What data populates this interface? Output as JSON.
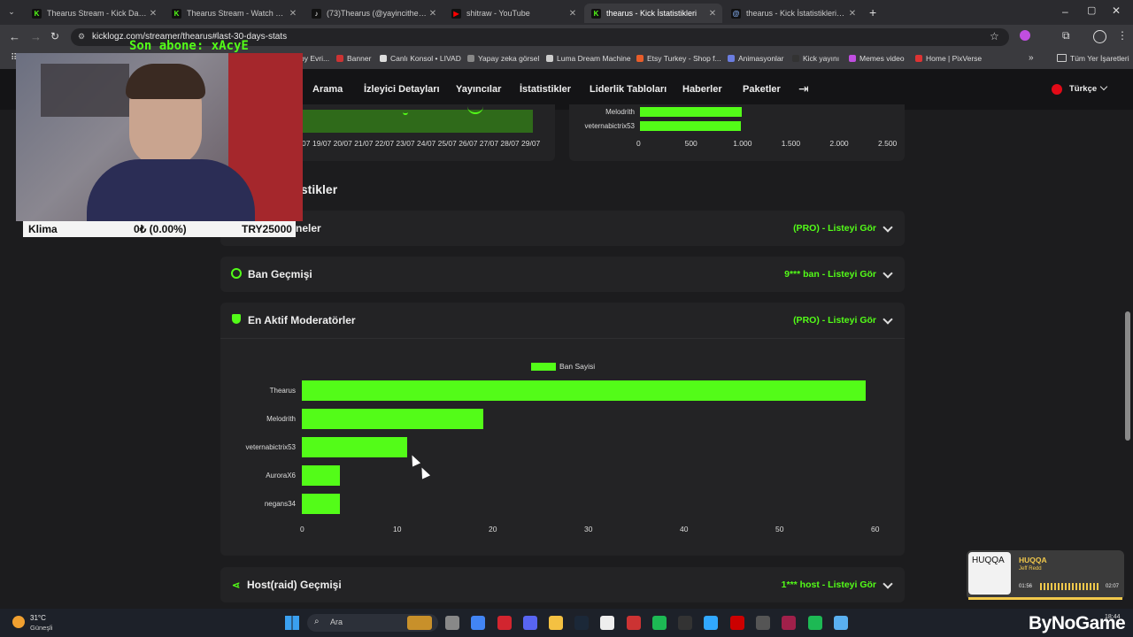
{
  "browser": {
    "tabs": [
      {
        "title": "Thearus Stream - Kick Dashboard",
        "icon": "K",
        "color": "#53fc18",
        "active": false
      },
      {
        "title": "Thearus Stream - Watch Live on Kick",
        "icon": "K",
        "color": "#53fc18",
        "active": false
      },
      {
        "title": "(73)Thearus (@yayincithearus) | TikTok",
        "icon": "♪",
        "color": "#ffffff",
        "active": false
      },
      {
        "title": "shitraw - YouTube",
        "icon": "▶",
        "color": "#ff0000",
        "active": false
      },
      {
        "title": "thearus - Kick İstatistikleri",
        "icon": "K",
        "color": "#53fc18",
        "active": true
      },
      {
        "title": "thearus - Kick İstatistikleri, Analiz",
        "icon": "@",
        "color": "#8ab4f8",
        "active": false
      }
    ],
    "url": "kicklogz.com/streamer/thearus#last-30-days-stats",
    "bookmarks": [
      "Banner",
      "Canlı Konsol • LIVAD",
      "Yapay zeka görsel",
      "Luma Dream Machine",
      "Etsy Turkey - Shop f...",
      "Animasyonlar",
      "Kick yayını",
      "Memes video",
      "Home | PixVerse"
    ],
    "bookmark_partial": "by Evri...",
    "bookmarks_folder": "Tüm Yer İşaretleri"
  },
  "site": {
    "nav": [
      "Arama",
      "İzleyici Detayları",
      "Yayıncılar",
      "İstatistikler",
      "Liderlik Tabloları",
      "Haberler",
      "Paketler"
    ],
    "language": "Türkçe",
    "accent": "#53fc18"
  },
  "top_charts": {
    "dates": [
      "07",
      "19/07",
      "20/07",
      "21/07",
      "22/07",
      "23/07",
      "24/07",
      "25/07",
      "26/07",
      "27/07",
      "28/07",
      "29/07"
    ],
    "mini_bar": {
      "categories": [
        "Melodrith",
        "veternabictrix53"
      ],
      "values": [
        1050,
        1040
      ],
      "ticks": [
        "0",
        "500",
        "1.000",
        "1.500",
        "2.000",
        "2.500"
      ],
      "xlim": [
        0,
        2500
      ]
    }
  },
  "section_heading": "istikler",
  "sections": [
    {
      "title": "neler",
      "right": "(PRO) - Listeyi Gör"
    },
    {
      "title": "Ban Geçmişi",
      "right": "9*** ban - Listeyi Gör"
    },
    {
      "title": "En Aktif Moderatörler",
      "right": "(PRO) - Listeyi Gör"
    },
    {
      "title": "Host(raid) Geçmişi",
      "right": "1*** host - Listeyi Gör"
    }
  ],
  "chart_data": {
    "type": "bar",
    "orientation": "horizontal",
    "categories": [
      "Thearus",
      "Melodrith",
      "veternabictrix53",
      "AuroraX6",
      "negans34"
    ],
    "series": [
      {
        "name": "Ban Sayisi",
        "values": [
          59,
          19,
          11,
          4,
          4
        ]
      }
    ],
    "xlim": [
      0,
      60
    ],
    "ticks": [
      "0",
      "10",
      "20",
      "30",
      "40",
      "50",
      "60"
    ],
    "legend": "top",
    "color": "#53fc18"
  },
  "overlay": {
    "sub_alert": "Son abone: xAcyE",
    "ticker_label": "Klima",
    "ticker_value": "0₺ (0.00%)",
    "ticker_goal": "TRY25000"
  },
  "music": {
    "art_text": "HUQQA",
    "title": "HUQQA",
    "artist": "Jeff Redd",
    "elapsed": "01:56",
    "total": "02:07"
  },
  "taskbar": {
    "weather_temp": "31°C",
    "weather_desc": "Güneşli",
    "search": "Ara",
    "time": "18:44",
    "watermark": "ByNoGame"
  }
}
